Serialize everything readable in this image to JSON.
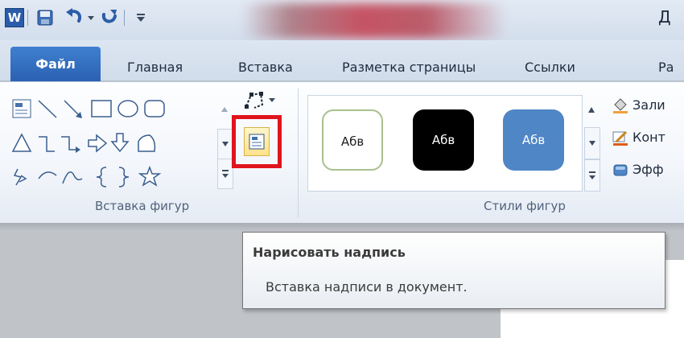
{
  "app": {
    "title_fragment": "Д"
  },
  "quick_access": {
    "app_icon": "W",
    "items": [
      "word-icon",
      "save-icon",
      "undo-icon",
      "redo-icon",
      "customize-icon"
    ]
  },
  "tabs": {
    "file": "Файл",
    "items": [
      "Главная",
      "Вставка",
      "Разметка страницы",
      "Ссылки",
      "Ра"
    ]
  },
  "ribbon": {
    "insert_shapes": {
      "label": "Вставка фигур",
      "shape_icons": [
        "text-box",
        "line",
        "arrow",
        "rectangle",
        "oval",
        "rounded-rectangle",
        "triangle",
        "elbow-connector",
        "elbow-arrow-connector",
        "right-arrow",
        "down-arrow",
        "flowchart-shape",
        "freeform",
        "arc",
        "curve",
        "left-brace",
        "right-brace",
        "star"
      ]
    },
    "shape_styles": {
      "label": "Стили фигур",
      "chips": [
        {
          "text": "Абв",
          "fill": "#ffffff",
          "color": "#1e1e1e"
        },
        {
          "text": "Абв",
          "fill": "#000000",
          "color": "#ffffff"
        },
        {
          "text": "Абв",
          "fill": "#4f86c6",
          "color": "#ffffff"
        }
      ]
    },
    "commands": {
      "fill": "Зали",
      "outline": "Конт",
      "effects": "Эфф"
    }
  },
  "tooltip": {
    "title": "Нарисовать надпись",
    "description": "Вставка надписи в документ."
  },
  "colors": {
    "file_tab": "#2a5fb0",
    "highlight": "#e0141e"
  }
}
